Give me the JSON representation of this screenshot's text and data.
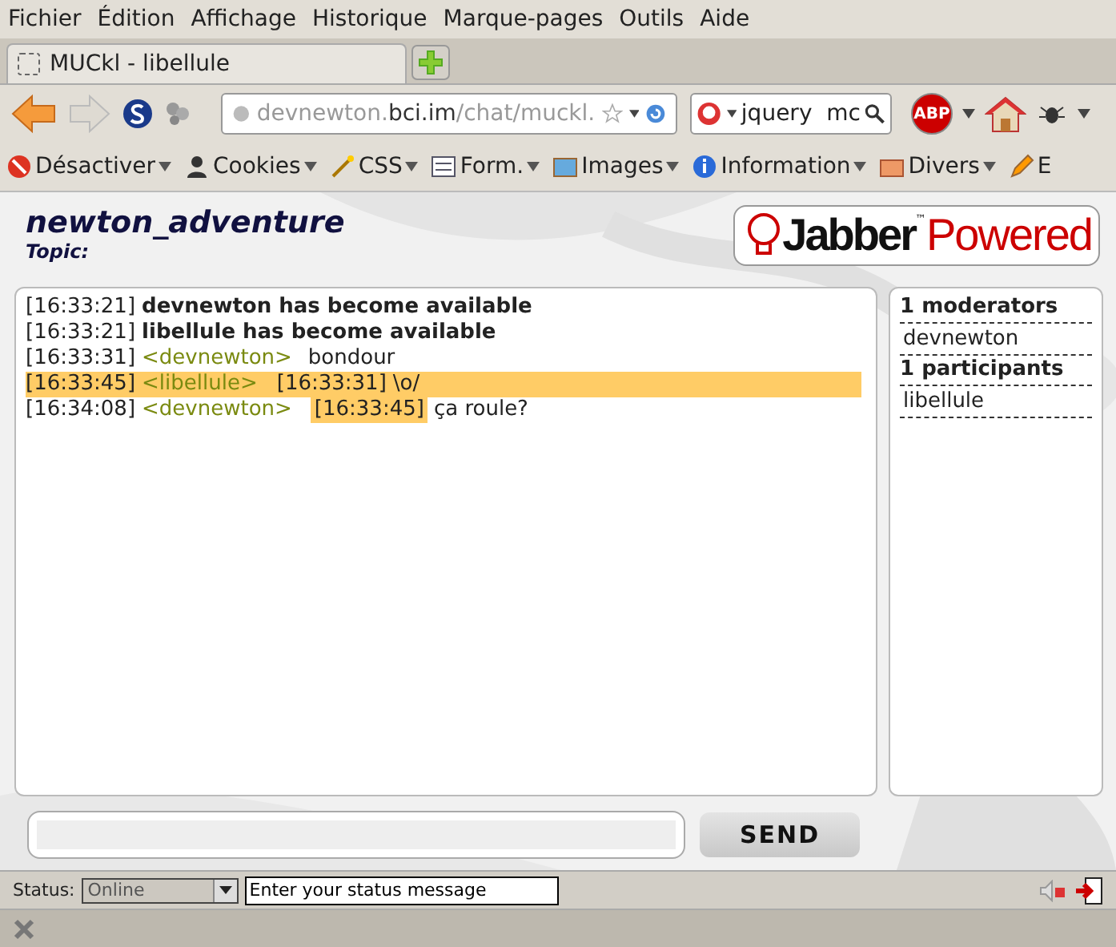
{
  "menu": [
    {
      "label": "Fichier"
    },
    {
      "label": "Édition"
    },
    {
      "label": "Affichage"
    },
    {
      "label": "Historique"
    },
    {
      "label": "Marque-pages"
    },
    {
      "label": "Outils"
    },
    {
      "label": "Aide"
    }
  ],
  "tabs": [
    {
      "title": "MUCkl - libellule",
      "selected": true
    }
  ],
  "nav": {
    "back_disabled": false,
    "forward_disabled": true,
    "url": {
      "host_prefix": "devnewton.",
      "domain": "bci.im",
      "path": "/chat/muckl."
    },
    "search": "jquery  mc",
    "abp": "ABP"
  },
  "devtools": [
    {
      "label": "Désactiver"
    },
    {
      "label": "Cookies"
    },
    {
      "label": "CSS"
    },
    {
      "label": "Form."
    },
    {
      "label": "Images"
    },
    {
      "label": "Information"
    },
    {
      "label": "Divers"
    },
    {
      "label": "E"
    }
  ],
  "room": {
    "name": "newton_adventure",
    "topic": "Topic:"
  },
  "logo": {
    "word": "Jabber",
    "tm": "™",
    "tagline": "Powered"
  },
  "messages": [
    {
      "kind": "presence",
      "time": "[16:33:21]",
      "text": "devnewton has become available",
      "highlighted": false
    },
    {
      "kind": "presence",
      "time": "[16:33:21]",
      "text": "libellule has become available",
      "highlighted": false
    },
    {
      "kind": "message",
      "time": "[16:33:31]",
      "nick": "<devnewton>",
      "text": "bondour",
      "highlighted": false
    },
    {
      "kind": "message",
      "time": "[16:33:45]",
      "nick": "<libellule>",
      "quote": {
        "text": "[16:33:31]",
        "highlighted": false
      },
      "text": "\\o/",
      "highlighted": true
    },
    {
      "kind": "message",
      "time": "[16:34:08]",
      "nick": "<devnewton>",
      "quote": {
        "text": "[16:33:45]",
        "highlighted": true
      },
      "text": "ça roule?",
      "highlighted": false
    }
  ],
  "roster": [
    {
      "heading": "1 moderators",
      "members": [
        "devnewton"
      ]
    },
    {
      "heading": "1 participants",
      "members": [
        "libellule"
      ]
    }
  ],
  "send_button": "SEND",
  "status_bar": {
    "label": "Status:",
    "status": "Online",
    "message": "Enter your status message"
  }
}
